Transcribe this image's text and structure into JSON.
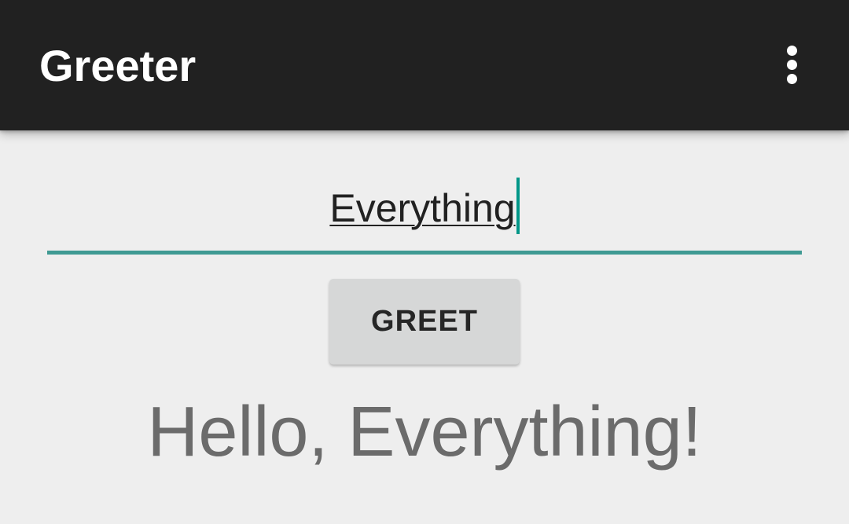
{
  "app_bar": {
    "title": "Greeter",
    "overflow_icon": "more-vert-icon",
    "background": "#212121"
  },
  "name_input": {
    "value": "Everything",
    "accent_color": "#009688"
  },
  "greet_button": {
    "label": "GREET"
  },
  "greeting": {
    "text": "Hello, Everything!"
  }
}
